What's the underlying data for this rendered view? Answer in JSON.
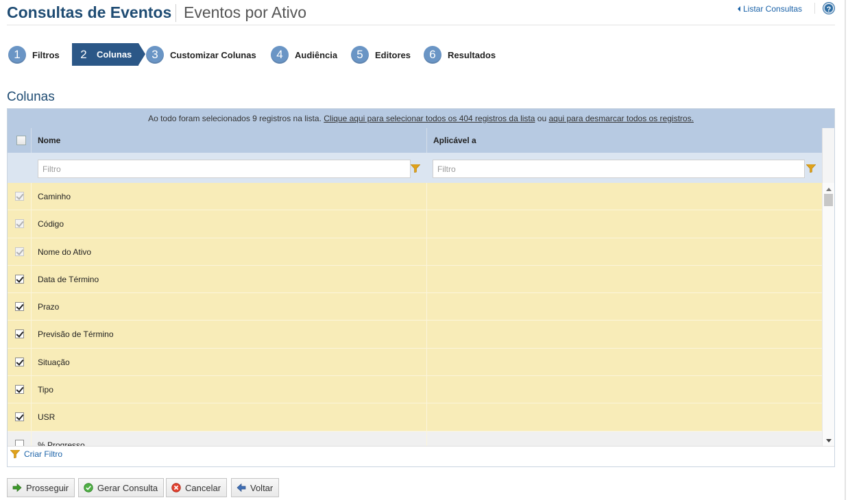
{
  "header": {
    "title": "Consultas de Eventos",
    "subtitle": "Eventos por Ativo",
    "list_link": "Listar Consultas",
    "help_glyph": "?"
  },
  "steps": [
    {
      "number": "1",
      "label": "Filtros",
      "active": false
    },
    {
      "number": "2",
      "label": "Colunas",
      "active": true
    },
    {
      "number": "3",
      "label": "Customizar Colunas",
      "active": false
    },
    {
      "number": "4",
      "label": "Audiência",
      "active": false
    },
    {
      "number": "5",
      "label": "Editores",
      "active": false
    },
    {
      "number": "6",
      "label": "Resultados",
      "active": false
    }
  ],
  "section": {
    "title": "Colunas"
  },
  "banner": {
    "text": "Ao todo foram selecionados 9 registros na lista.",
    "select_all_link": "Clique aqui para selecionar todos os 404 registros da lista",
    "middle": "ou",
    "deselect_link": "aqui para desmarcar todos os registros."
  },
  "table": {
    "columns": {
      "name": "Nome",
      "applies_to": "Aplicável a"
    },
    "filter_placeholder": "Filtro",
    "rows": [
      {
        "name": "Caminho",
        "checked": true,
        "disabled": true
      },
      {
        "name": "Código",
        "checked": true,
        "disabled": true
      },
      {
        "name": "Nome do Ativo",
        "checked": true,
        "disabled": true
      },
      {
        "name": "Data de Término",
        "checked": true,
        "disabled": false
      },
      {
        "name": "Prazo",
        "checked": true,
        "disabled": false
      },
      {
        "name": "Previsão de Término",
        "checked": true,
        "disabled": false
      },
      {
        "name": "Situação",
        "checked": true,
        "disabled": false
      },
      {
        "name": "Tipo",
        "checked": true,
        "disabled": false
      },
      {
        "name": "USR",
        "checked": true,
        "disabled": false
      },
      {
        "name": "% Progresso",
        "checked": false,
        "disabled": false
      }
    ]
  },
  "footer": {
    "create_filter": "Criar Filtro"
  },
  "buttons": {
    "proceed": "Prosseguir",
    "generate": "Gerar Consulta",
    "cancel": "Cancelar",
    "back": "Voltar"
  },
  "colors": {
    "brand_blue": "#1f4c73",
    "active_step": "#2b5787",
    "step_circle": "#6a95c5",
    "header_row": "#b7cae2",
    "selected_row": "#f8ecb8"
  }
}
